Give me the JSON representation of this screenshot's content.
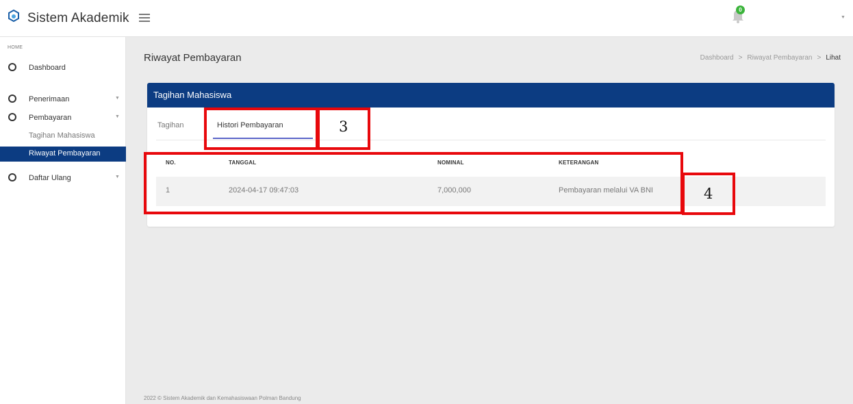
{
  "app": {
    "title": "Sistem Akademik"
  },
  "header": {
    "notification_count": "0"
  },
  "sidebar": {
    "section": "HOME",
    "items": [
      {
        "label": "Dashboard"
      },
      {
        "label": "Penerimaan"
      },
      {
        "label": "Pembayaran"
      },
      {
        "label": "Tagihan Mahasiswa"
      },
      {
        "label": "Riwayat Pembayaran"
      },
      {
        "label": "Daftar Ulang"
      }
    ]
  },
  "page": {
    "title": "Riwayat Pembayaran",
    "breadcrumb": [
      "Dashboard",
      "Riwayat Pembayaran",
      "Lihat"
    ],
    "breadcrumb_sep": ">"
  },
  "card": {
    "title": "Tagihan Mahasiswa",
    "tabs": [
      {
        "label": "Tagihan"
      },
      {
        "label": "Histori Pembayaran"
      }
    ],
    "table": {
      "columns": [
        "NO.",
        "TANGGAL",
        "NOMINAL",
        "KETERANGAN"
      ],
      "rows": [
        {
          "no": "1",
          "tanggal": "2024-04-17 09:47:03",
          "nominal": "7,000,000",
          "keterangan": "Pembayaran melalui VA BNI"
        }
      ]
    }
  },
  "annotations": {
    "tab_box": "3",
    "table_box": "4"
  },
  "footer": {
    "text": "2022 © Sistem Akademik dan Kemahasiswaan Polman Bandung"
  },
  "colors": {
    "brand": "#0c3c82",
    "tab_indicator": "#5a64c8",
    "annotation": "#e8080c",
    "badge": "#3cb43c"
  }
}
